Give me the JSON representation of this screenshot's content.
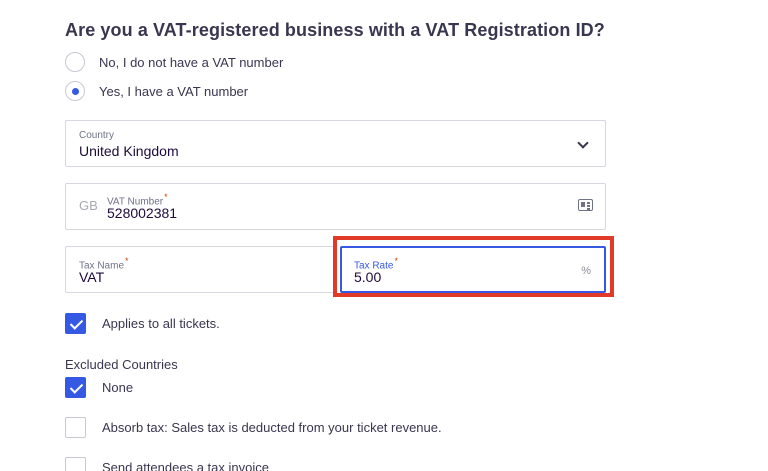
{
  "vat_question": {
    "title": "Are you a VAT-registered business with a VAT Registration ID?",
    "options": [
      {
        "label": "No, I do not have a VAT number",
        "selected": false
      },
      {
        "label": "Yes, I have a VAT number",
        "selected": true
      }
    ]
  },
  "country": {
    "label": "Country",
    "value": "United Kingdom",
    "icon": "chevron-down-icon"
  },
  "vat_number": {
    "prefix": "GB",
    "label": "VAT Number",
    "required_mark": "*",
    "value": "528002381",
    "icon": "id-card-icon"
  },
  "tax_name": {
    "label": "Tax Name",
    "required_mark": "*",
    "value": "VAT"
  },
  "tax_rate": {
    "label": "Tax Rate",
    "required_mark": "*",
    "value": "5.00",
    "suffix": "%"
  },
  "applies_all": {
    "label": "Applies to all tickets.",
    "checked": true
  },
  "excluded_countries": {
    "title": "Excluded Countries",
    "none_label": "None",
    "none_checked": true
  },
  "absorb_tax": {
    "label": "Absorb tax: Sales tax is deducted from your ticket revenue.",
    "checked": false
  },
  "send_invoice": {
    "label": "Send attendees a tax invoice",
    "checked": false
  },
  "colors": {
    "accent": "#3659e3",
    "highlight": "#e23a28",
    "required": "#d1410c",
    "text": "#39364f"
  }
}
